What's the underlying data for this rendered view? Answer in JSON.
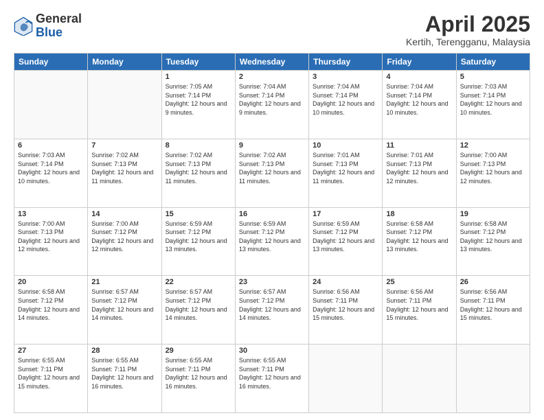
{
  "header": {
    "logo_general": "General",
    "logo_blue": "Blue",
    "month_title": "April 2025",
    "location": "Kertih, Terengganu, Malaysia"
  },
  "weekdays": [
    "Sunday",
    "Monday",
    "Tuesday",
    "Wednesday",
    "Thursday",
    "Friday",
    "Saturday"
  ],
  "weeks": [
    [
      {
        "day": "",
        "info": ""
      },
      {
        "day": "",
        "info": ""
      },
      {
        "day": "1",
        "info": "Sunrise: 7:05 AM\nSunset: 7:14 PM\nDaylight: 12 hours and 9 minutes."
      },
      {
        "day": "2",
        "info": "Sunrise: 7:04 AM\nSunset: 7:14 PM\nDaylight: 12 hours and 9 minutes."
      },
      {
        "day": "3",
        "info": "Sunrise: 7:04 AM\nSunset: 7:14 PM\nDaylight: 12 hours and 10 minutes."
      },
      {
        "day": "4",
        "info": "Sunrise: 7:04 AM\nSunset: 7:14 PM\nDaylight: 12 hours and 10 minutes."
      },
      {
        "day": "5",
        "info": "Sunrise: 7:03 AM\nSunset: 7:14 PM\nDaylight: 12 hours and 10 minutes."
      }
    ],
    [
      {
        "day": "6",
        "info": "Sunrise: 7:03 AM\nSunset: 7:14 PM\nDaylight: 12 hours and 10 minutes."
      },
      {
        "day": "7",
        "info": "Sunrise: 7:02 AM\nSunset: 7:13 PM\nDaylight: 12 hours and 11 minutes."
      },
      {
        "day": "8",
        "info": "Sunrise: 7:02 AM\nSunset: 7:13 PM\nDaylight: 12 hours and 11 minutes."
      },
      {
        "day": "9",
        "info": "Sunrise: 7:02 AM\nSunset: 7:13 PM\nDaylight: 12 hours and 11 minutes."
      },
      {
        "day": "10",
        "info": "Sunrise: 7:01 AM\nSunset: 7:13 PM\nDaylight: 12 hours and 11 minutes."
      },
      {
        "day": "11",
        "info": "Sunrise: 7:01 AM\nSunset: 7:13 PM\nDaylight: 12 hours and 12 minutes."
      },
      {
        "day": "12",
        "info": "Sunrise: 7:00 AM\nSunset: 7:13 PM\nDaylight: 12 hours and 12 minutes."
      }
    ],
    [
      {
        "day": "13",
        "info": "Sunrise: 7:00 AM\nSunset: 7:13 PM\nDaylight: 12 hours and 12 minutes."
      },
      {
        "day": "14",
        "info": "Sunrise: 7:00 AM\nSunset: 7:12 PM\nDaylight: 12 hours and 12 minutes."
      },
      {
        "day": "15",
        "info": "Sunrise: 6:59 AM\nSunset: 7:12 PM\nDaylight: 12 hours and 13 minutes."
      },
      {
        "day": "16",
        "info": "Sunrise: 6:59 AM\nSunset: 7:12 PM\nDaylight: 12 hours and 13 minutes."
      },
      {
        "day": "17",
        "info": "Sunrise: 6:59 AM\nSunset: 7:12 PM\nDaylight: 12 hours and 13 minutes."
      },
      {
        "day": "18",
        "info": "Sunrise: 6:58 AM\nSunset: 7:12 PM\nDaylight: 12 hours and 13 minutes."
      },
      {
        "day": "19",
        "info": "Sunrise: 6:58 AM\nSunset: 7:12 PM\nDaylight: 12 hours and 13 minutes."
      }
    ],
    [
      {
        "day": "20",
        "info": "Sunrise: 6:58 AM\nSunset: 7:12 PM\nDaylight: 12 hours and 14 minutes."
      },
      {
        "day": "21",
        "info": "Sunrise: 6:57 AM\nSunset: 7:12 PM\nDaylight: 12 hours and 14 minutes."
      },
      {
        "day": "22",
        "info": "Sunrise: 6:57 AM\nSunset: 7:12 PM\nDaylight: 12 hours and 14 minutes."
      },
      {
        "day": "23",
        "info": "Sunrise: 6:57 AM\nSunset: 7:12 PM\nDaylight: 12 hours and 14 minutes."
      },
      {
        "day": "24",
        "info": "Sunrise: 6:56 AM\nSunset: 7:11 PM\nDaylight: 12 hours and 15 minutes."
      },
      {
        "day": "25",
        "info": "Sunrise: 6:56 AM\nSunset: 7:11 PM\nDaylight: 12 hours and 15 minutes."
      },
      {
        "day": "26",
        "info": "Sunrise: 6:56 AM\nSunset: 7:11 PM\nDaylight: 12 hours and 15 minutes."
      }
    ],
    [
      {
        "day": "27",
        "info": "Sunrise: 6:55 AM\nSunset: 7:11 PM\nDaylight: 12 hours and 15 minutes."
      },
      {
        "day": "28",
        "info": "Sunrise: 6:55 AM\nSunset: 7:11 PM\nDaylight: 12 hours and 16 minutes."
      },
      {
        "day": "29",
        "info": "Sunrise: 6:55 AM\nSunset: 7:11 PM\nDaylight: 12 hours and 16 minutes."
      },
      {
        "day": "30",
        "info": "Sunrise: 6:55 AM\nSunset: 7:11 PM\nDaylight: 12 hours and 16 minutes."
      },
      {
        "day": "",
        "info": ""
      },
      {
        "day": "",
        "info": ""
      },
      {
        "day": "",
        "info": ""
      }
    ]
  ]
}
